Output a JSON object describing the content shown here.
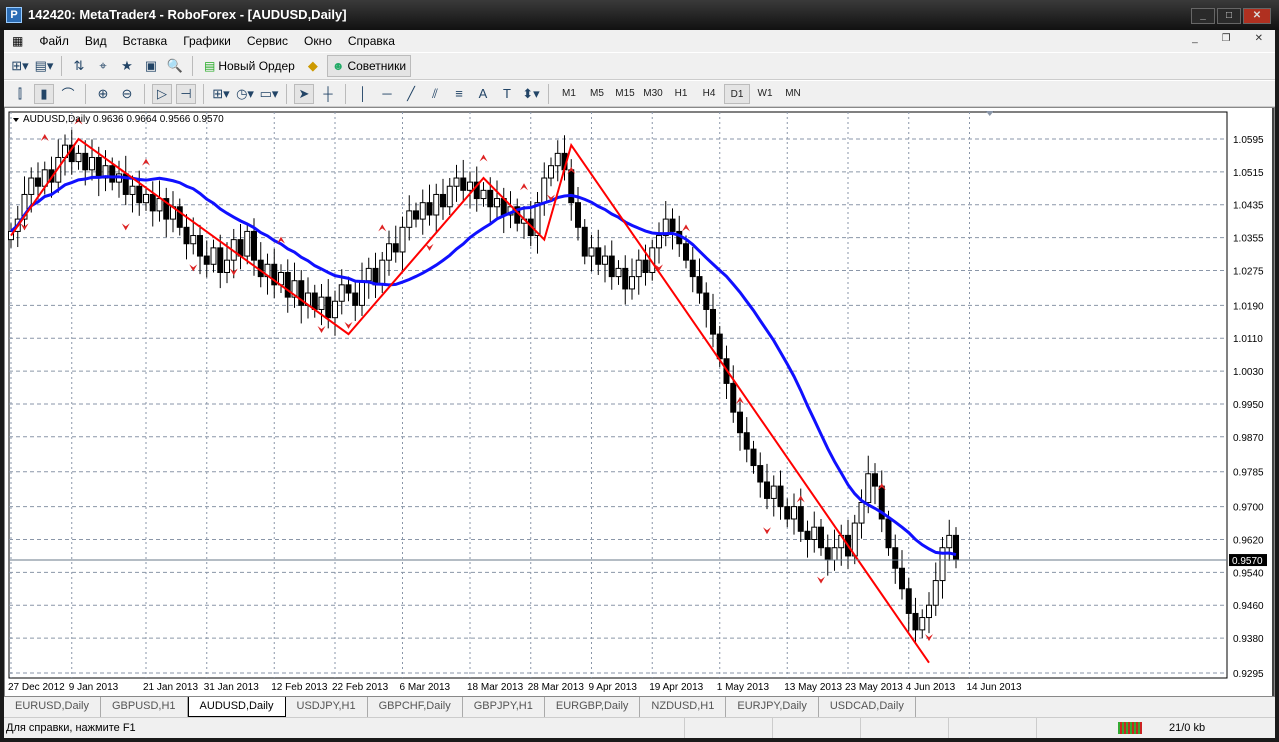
{
  "window": {
    "title": "142420: MetaTrader4 - RoboForex - [AUDUSD,Daily]",
    "logo": "P"
  },
  "menu": [
    "Файл",
    "Вид",
    "Вставка",
    "Графики",
    "Сервис",
    "Окно",
    "Справка"
  ],
  "toolbar": {
    "new_order": "Новый Ордер",
    "experts": "Советники"
  },
  "drawing_tools": {
    "text_label": "A"
  },
  "timeframes": [
    "M1",
    "M5",
    "M15",
    "M30",
    "H1",
    "H4",
    "D1",
    "W1",
    "MN"
  ],
  "active_timeframe": "D1",
  "tabs": [
    "EURUSD,Daily",
    "GBPUSD,H1",
    "AUDUSD,Daily",
    "USDJPY,H1",
    "GBPCHF,Daily",
    "GBPJPY,H1",
    "EURGBP,Daily",
    "NZDUSD,H1",
    "EURJPY,Daily",
    "USDCAD,Daily"
  ],
  "active_tab": "AUDUSD,Daily",
  "status": {
    "help": "Для справки, нажмите F1",
    "traffic": "21/0 kb"
  },
  "chart_data": {
    "type": "candlestick",
    "title": "AUDUSD,Daily  0.9636 0.9664 0.9566 0.9570",
    "current_price": "0.9570",
    "ylim": [
      0.9295,
      1.0595
    ],
    "y_ticks": [
      "1.0595",
      "1.0515",
      "1.0435",
      "1.0355",
      "1.0275",
      "1.0190",
      "1.0110",
      "1.0030",
      "0.9950",
      "0.9870",
      "0.9785",
      "0.9700",
      "0.9620",
      "0.9540",
      "0.9460",
      "0.9380",
      "0.9295"
    ],
    "x_ticks": [
      {
        "bar": 0,
        "label": "27 Dec 2012"
      },
      {
        "bar": 9,
        "label": "9 Jan 2013"
      },
      {
        "bar": 20,
        "label": "21 Jan 2013"
      },
      {
        "bar": 29,
        "label": "31 Jan 2013"
      },
      {
        "bar": 39,
        "label": "12 Feb 2013"
      },
      {
        "bar": 48,
        "label": "22 Feb 2013"
      },
      {
        "bar": 58,
        "label": "6 Mar 2013"
      },
      {
        "bar": 68,
        "label": "18 Mar 2013"
      },
      {
        "bar": 77,
        "label": "28 Mar 2013"
      },
      {
        "bar": 86,
        "label": "9 Apr 2013"
      },
      {
        "bar": 95,
        "label": "19 Apr 2013"
      },
      {
        "bar": 105,
        "label": "1 May 2013"
      },
      {
        "bar": 115,
        "label": "13 May 2013"
      },
      {
        "bar": 124,
        "label": "23 May 2013"
      },
      {
        "bar": 133,
        "label": "4 Jun 2013"
      },
      {
        "bar": 142,
        "label": "14 Jun 2013"
      }
    ],
    "closes": [
      1.037,
      1.04,
      1.046,
      1.05,
      1.048,
      1.052,
      1.049,
      1.055,
      1.058,
      1.054,
      1.056,
      1.052,
      1.055,
      1.05,
      1.053,
      1.049,
      1.051,
      1.046,
      1.048,
      1.044,
      1.046,
      1.042,
      1.045,
      1.04,
      1.043,
      1.038,
      1.034,
      1.036,
      1.031,
      1.029,
      1.033,
      1.027,
      1.03,
      1.035,
      1.031,
      1.037,
      1.03,
      1.026,
      1.029,
      1.024,
      1.027,
      1.021,
      1.025,
      1.019,
      1.022,
      1.018,
      1.021,
      1.016,
      1.02,
      1.024,
      1.022,
      1.019,
      1.025,
      1.028,
      1.024,
      1.03,
      1.034,
      1.032,
      1.038,
      1.042,
      1.04,
      1.044,
      1.041,
      1.046,
      1.043,
      1.048,
      1.05,
      1.047,
      1.049,
      1.045,
      1.047,
      1.043,
      1.045,
      1.041,
      1.043,
      1.039,
      1.04,
      1.036,
      1.044,
      1.05,
      1.053,
      1.056,
      1.052,
      1.044,
      1.038,
      1.031,
      1.033,
      1.029,
      1.031,
      1.026,
      1.028,
      1.023,
      1.026,
      1.03,
      1.027,
      1.033,
      1.036,
      1.04,
      1.037,
      1.034,
      1.03,
      1.026,
      1.022,
      1.018,
      1.012,
      1.006,
      1.0,
      0.993,
      0.988,
      0.984,
      0.98,
      0.976,
      0.972,
      0.975,
      0.97,
      0.967,
      0.97,
      0.964,
      0.962,
      0.965,
      0.96,
      0.957,
      0.96,
      0.963,
      0.958,
      0.966,
      0.971,
      0.978,
      0.975,
      0.967,
      0.96,
      0.955,
      0.95,
      0.944,
      0.94,
      0.943,
      0.946,
      0.952,
      0.96,
      0.963,
      0.957
    ],
    "ma_period": 21,
    "zigzag": [
      [
        0,
        1.036
      ],
      [
        10,
        1.0595
      ],
      [
        50,
        1.012
      ],
      [
        70,
        1.05
      ],
      [
        79,
        1.035
      ],
      [
        83,
        1.058
      ],
      [
        136,
        0.932
      ]
    ],
    "fractals_up": [
      5,
      10,
      20,
      40,
      55,
      70,
      76,
      83,
      100,
      108,
      117,
      129
    ],
    "fractals_down": [
      2,
      17,
      27,
      33,
      46,
      50,
      62,
      80,
      96,
      112,
      120,
      136
    ]
  }
}
